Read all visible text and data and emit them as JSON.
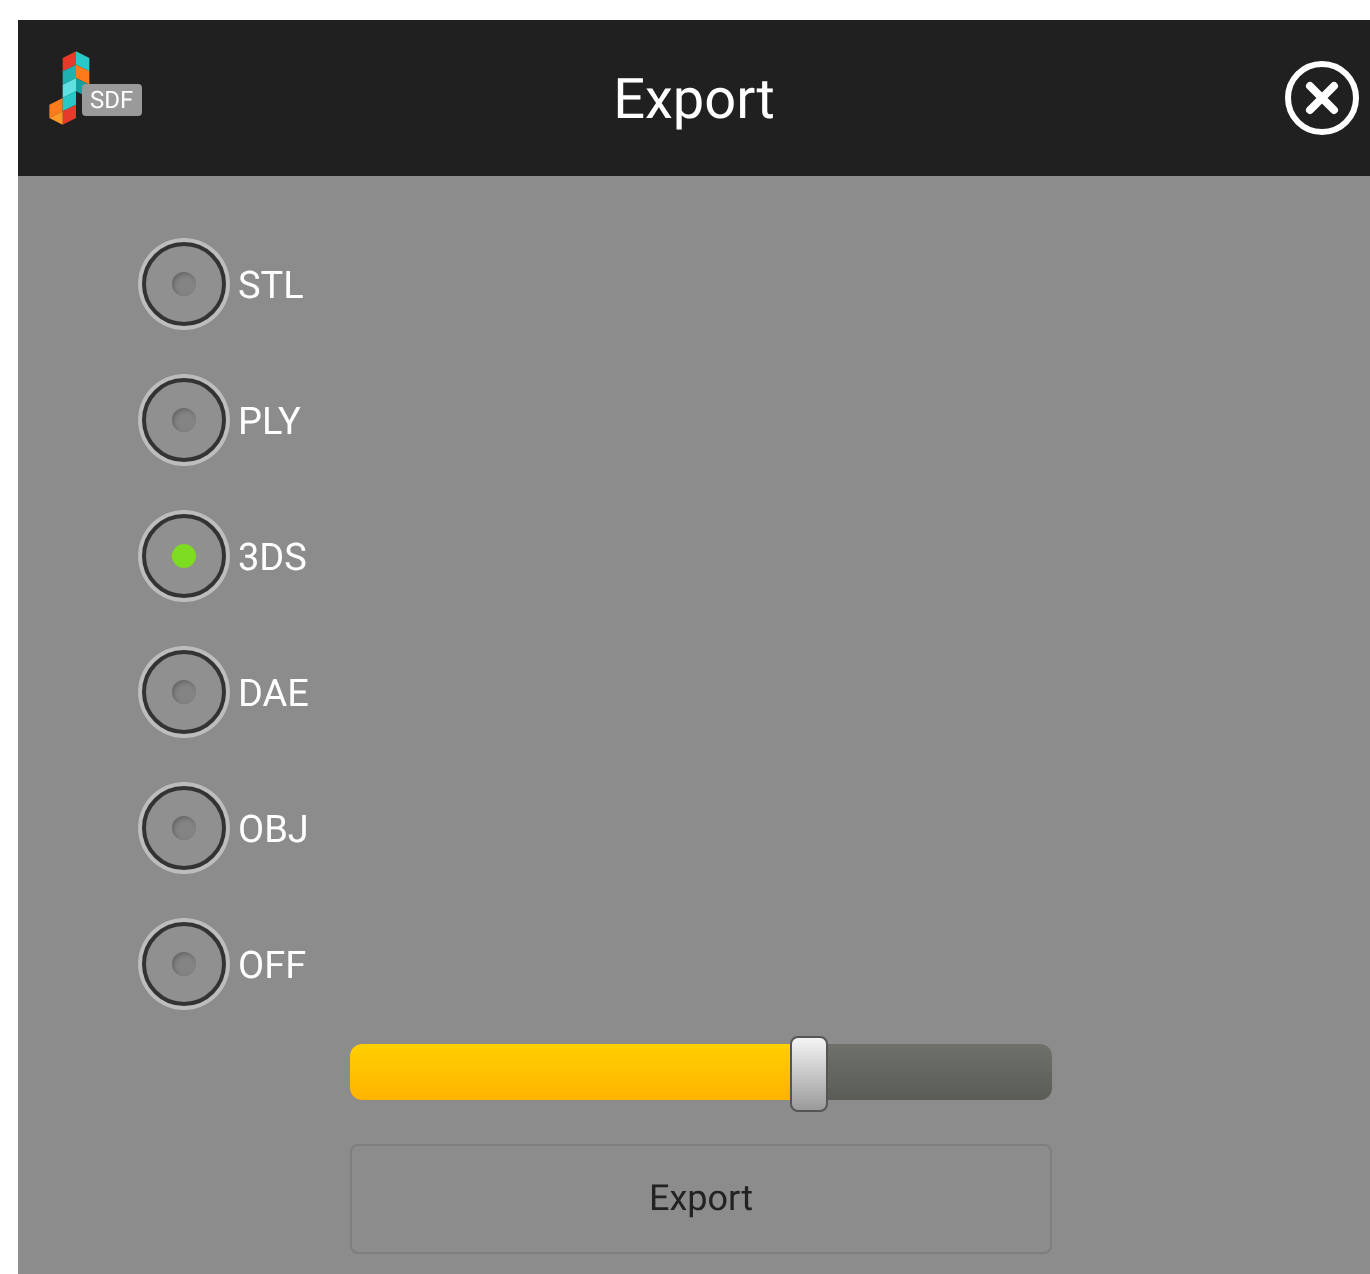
{
  "window": {
    "title": "Export",
    "logo_text": "SDF"
  },
  "formats": [
    {
      "label": "STL",
      "selected": false
    },
    {
      "label": "PLY",
      "selected": false
    },
    {
      "label": "3DS",
      "selected": true
    },
    {
      "label": "DAE",
      "selected": false
    },
    {
      "label": "OBJ",
      "selected": false
    },
    {
      "label": "OFF",
      "selected": false
    }
  ],
  "slider": {
    "level": 0.655
  },
  "button": {
    "label": "Export"
  }
}
